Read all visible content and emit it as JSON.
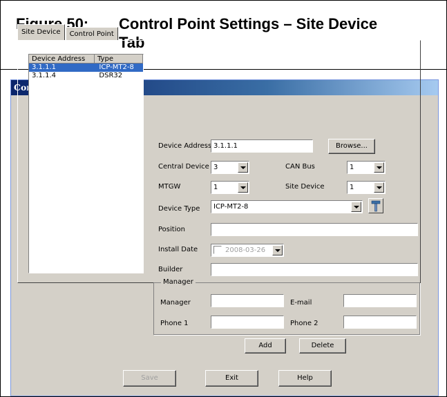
{
  "caption": {
    "number": "Figure 50:",
    "title_line1": "Control Point Settings – Site Device",
    "title_line2": "Tab"
  },
  "window": {
    "title": "Control Point Settings"
  },
  "tabs": [
    {
      "label": "Site Device",
      "active": true
    },
    {
      "label": "Control Point",
      "active": false
    }
  ],
  "device_list": {
    "columns": [
      "Device Address",
      "Type"
    ],
    "rows": [
      {
        "address": "3.1.1.1",
        "type": "ICP-MT2-8",
        "selected": true
      },
      {
        "address": "3.1.1.4",
        "type": "DSR32",
        "selected": false
      }
    ]
  },
  "form": {
    "device_address_label": "Device Address",
    "device_address_value": "3.1.1.1",
    "browse_label": "Browse...",
    "central_device_label": "Central Device",
    "central_device_value": "3",
    "can_bus_label": "CAN Bus",
    "can_bus_value": "1",
    "mtgw_label": "MTGW",
    "mtgw_value": "1",
    "site_device_label": "Site Device",
    "site_device_value": "1",
    "device_type_label": "Device Type",
    "device_type_value": "ICP-MT2-8",
    "position_label": "Position",
    "position_value": "",
    "install_date_label": "Install Date",
    "install_date_value": "2008-03-26",
    "builder_label": "Builder",
    "builder_value": ""
  },
  "manager_group": {
    "title": "Manager",
    "manager_label": "Manager",
    "email_label": "E-mail",
    "phone1_label": "Phone 1",
    "phone2_label": "Phone 2"
  },
  "actions": {
    "add": "Add",
    "delete": "Delete"
  },
  "footer": {
    "save": "Save",
    "exit": "Exit",
    "help": "Help"
  },
  "icons": {
    "device_type_tool": "hammer-icon"
  }
}
